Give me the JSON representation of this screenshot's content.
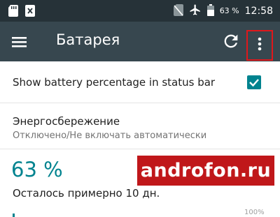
{
  "status_bar": {
    "battery_percent": "63 %",
    "time": "12:58",
    "icons": [
      "sd-card-icon",
      "notification-x-icon",
      "no-sim-icon",
      "airplane-icon",
      "battery-icon"
    ]
  },
  "toolbar": {
    "title": "Батарея",
    "icons": [
      "menu-icon",
      "refresh-icon",
      "more-vert-icon"
    ]
  },
  "settings": {
    "show_percentage": {
      "label": "Show battery percentage in status bar",
      "checked": true
    },
    "power_saving": {
      "title": "Энергосбережение",
      "subtitle": "Отключено/Не включать автоматически"
    }
  },
  "battery": {
    "percent": "63 %",
    "remaining": "Осталось примерно 10 дн.",
    "chart_top_label": "100%"
  },
  "watermark": {
    "text": "androfon.ru"
  },
  "colors": {
    "status_bar": "#263238",
    "toolbar": "#37474f",
    "accent": "#00838f",
    "highlight": "#e0171b"
  }
}
